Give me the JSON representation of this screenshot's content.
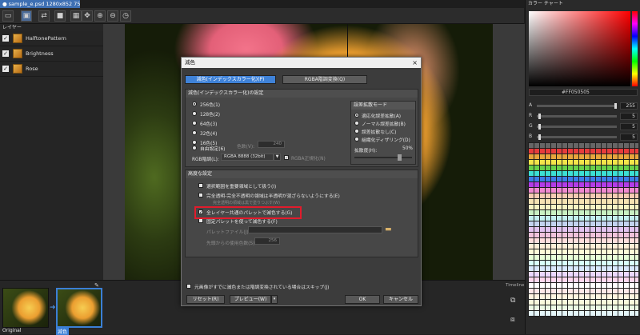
{
  "doc_tab": {
    "title": "sample_e.psd  1280x852  75%"
  },
  "layers": {
    "title": "レイヤー",
    "items": [
      {
        "name": "HalftonePattern"
      },
      {
        "name": "Brightness"
      },
      {
        "name": "Rose"
      }
    ]
  },
  "color_panel": {
    "title": "カラー チャート",
    "hex": "#FF050505",
    "sliders": [
      {
        "label": "A",
        "value": "255",
        "level": 1.0
      },
      {
        "label": "R",
        "value": "5",
        "level": 0.02
      },
      {
        "label": "G",
        "value": "5",
        "level": 0.02
      },
      {
        "label": "B",
        "value": "5",
        "level": 0.02
      }
    ]
  },
  "filmstrip": {
    "timeline_label": "Timeline",
    "frames": [
      {
        "label": "Original"
      },
      {
        "label": "減色"
      }
    ]
  },
  "dialog": {
    "title": "減色",
    "close": "×",
    "tabs": {
      "indexed": "減色(インデックスカラー化)(P)",
      "rgba": "RGBA階調変換(Q)"
    },
    "group_settings": "減色(インデックスカラー化)の設定",
    "colors": [
      {
        "label": "256色(1)",
        "checked": true
      },
      {
        "label": "128色(2)",
        "checked": false
      },
      {
        "label": "64色(3)",
        "checked": false
      },
      {
        "label": "32色(4)",
        "checked": false
      },
      {
        "label": "16色(5)",
        "checked": false
      },
      {
        "label": "自由設定(6)",
        "checked": false
      }
    ],
    "color_count_label": "色数(V):",
    "color_count_value": "240",
    "rgba_label": "RGB階調(L):",
    "rgba_value": "RGBA 8888 (32bit)",
    "rgba_normalize": "RGBA正規化(N)",
    "dither_title": "誤差拡散モード",
    "dither_modes": [
      {
        "label": "適応化誤差拡散(A)",
        "checked": true
      },
      {
        "label": "ノーマル誤差拡散(B)",
        "checked": false
      },
      {
        "label": "誤差拡散なし(C)",
        "checked": false
      },
      {
        "label": "組織化ディザリング(D)",
        "checked": false
      }
    ],
    "diffusion_label": "拡散度(H):",
    "diffusion_value": "50%",
    "advanced_title": "高度な設定",
    "advanced_options": [
      {
        "label": "選択範囲を重要領域として扱う(I)",
        "checked": false
      },
      {
        "label": "完全透明-完全不透明の領域は半透明が混ざらないようにする(E)",
        "checked": false
      },
      {
        "label": "完全透明の領域は黒で塗りつぶす(W)",
        "checked": false,
        "dim": true
      },
      {
        "label": "全レイヤー共通のパレットで減色する(G)",
        "checked": true
      },
      {
        "label": "固定パレットを使って減色する(F)",
        "checked": false
      }
    ],
    "palette_file_label": "パレットファイル(J):",
    "palette_count_label": "先頭からの使用色数(S):",
    "palette_count_value": "256",
    "skip_label": "元画像がすでに減色または階調変換されている場合はスキップ(J)",
    "reset_button": "リセット(R)",
    "preview_button": "プレビュー(W)",
    "ok_button": "OK",
    "cancel_button": "キャンセル"
  }
}
